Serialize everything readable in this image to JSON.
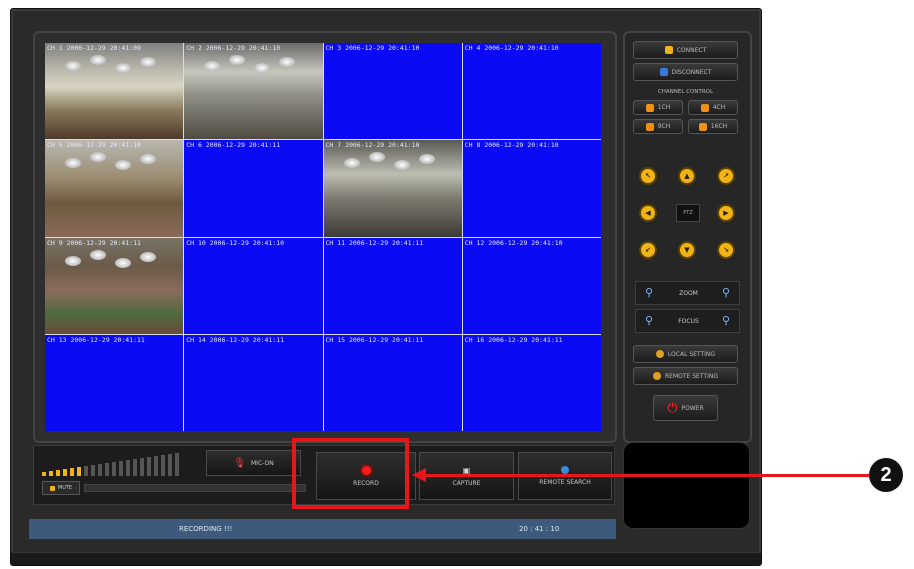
{
  "cameras": [
    {
      "label": "CH 1 2006-12-29 20:41:09",
      "feed": true
    },
    {
      "label": "CH 2 2006-12-29 20:41:10",
      "feed": true
    },
    {
      "label": "CH 3 2006-12-29 20:41:10",
      "feed": false
    },
    {
      "label": "CH 4 2006-12-29 20:41:10",
      "feed": false
    },
    {
      "label": "CH 5 2006-12-29 20:41:10",
      "feed": true
    },
    {
      "label": "CH 6 2006-12-29 20:41:11",
      "feed": false
    },
    {
      "label": "CH 7 2006-12-29 20:41:10",
      "feed": true
    },
    {
      "label": "CH 8 2006-12-29 20:41:10",
      "feed": false
    },
    {
      "label": "CH 9 2006-12-29 20:41:11",
      "feed": true
    },
    {
      "label": "CH 10 2006-12-29 20:41:10",
      "feed": false
    },
    {
      "label": "CH 11 2006-12-29 20:41:11",
      "feed": false
    },
    {
      "label": "CH 12 2006-12-29 20:41:10",
      "feed": false
    },
    {
      "label": "CH 13 2006-12-29 20:41:11",
      "feed": false
    },
    {
      "label": "CH 14 2006-12-29 20:41:11",
      "feed": false
    },
    {
      "label": "CH 15 2006-12-29 20:41:11",
      "feed": false
    },
    {
      "label": "CH 16 2006-12-29 20:41:11",
      "feed": false
    }
  ],
  "side": {
    "connect": "CONNECT",
    "disconnect": "DISCONNECT",
    "channel_control": "CHANNEL CONTROL",
    "ch1": "1CH",
    "ch4": "4CH",
    "ch9": "9CH",
    "ch16": "16CH",
    "ptz": "PTZ",
    "zoom": "ZOOM",
    "focus": "FOCUS",
    "local_setting": "LOCAL SETTING",
    "remote_setting": "REMOTE SETTING",
    "power": "POWER"
  },
  "bottom": {
    "mute": "MUTE",
    "mic_on": "MIC-ON",
    "record": "RECORD",
    "capture": "CAPTURE",
    "remote_search": "REMOTE SEARCH"
  },
  "status": {
    "recording": "RECORDING !!!",
    "time": "20 : 41 : 10"
  },
  "callout": "2",
  "colors": {
    "empty_channel": "#0a0af5",
    "highlight": "#e8151b",
    "status_bar": "#3d5a7c",
    "ptz_button": "#f2b316"
  }
}
